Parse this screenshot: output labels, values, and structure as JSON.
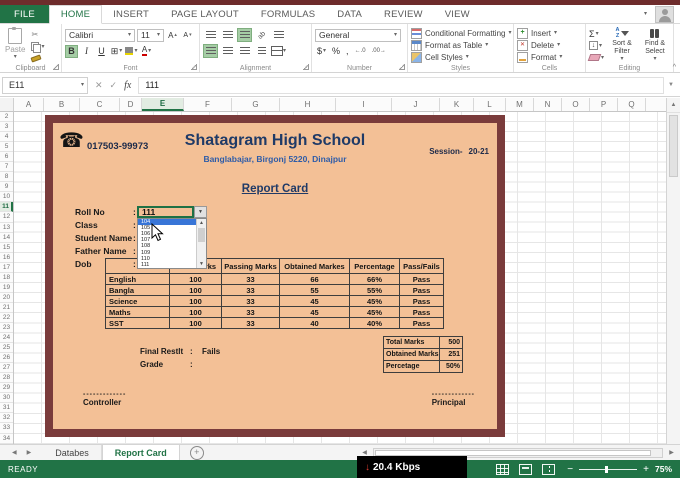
{
  "icons": {
    "caret": "▾",
    "caret_up": "^",
    "check": "✓",
    "cross": "✕",
    "fx": "fx",
    "sigma": "Σ",
    "phone": "☎",
    "up": "▲",
    "down": "▼",
    "left": "◀",
    "right": "▶",
    "plus": "+",
    "minus": "−",
    "fill_down": "↓",
    "net_down": "↓",
    "borders": "⊞",
    "dollar": "$",
    "percent": "%",
    "comma": ",",
    "dec_inc": "←.0",
    "dec_dec": ".00→",
    "grow_font": "A",
    "shrink_font": "A",
    "orientation": "ab",
    "az_a": "A",
    "az_z": "Z",
    "new_sheet": "+",
    "cursor_note": ""
  },
  "ribbon": {
    "tabs": [
      {
        "label": "FILE",
        "file": true
      },
      {
        "label": "HOME",
        "active": true
      },
      {
        "label": "INSERT"
      },
      {
        "label": "PAGE LAYOUT"
      },
      {
        "label": "FORMULAS"
      },
      {
        "label": "DATA"
      },
      {
        "label": "REVIEW"
      },
      {
        "label": "VIEW"
      }
    ],
    "clipboard": {
      "label": "Clipboard",
      "paste": "Paste"
    },
    "font": {
      "label": "Font",
      "family": "Calibri",
      "size": "11",
      "bold": "B",
      "italic": "I",
      "underline": "U"
    },
    "alignment": {
      "label": "Alignment"
    },
    "number": {
      "label": "Number",
      "format": "General"
    },
    "styles": {
      "label": "Styles",
      "conditional": "Conditional Formatting",
      "table": "Format as Table",
      "cell": "Cell Styles"
    },
    "cells": {
      "label": "Cells",
      "insert": "Insert",
      "delete": "Delete",
      "format": "Format"
    },
    "editing": {
      "label": "Editing",
      "sort": "Sort & Filter",
      "find": "Find & Select"
    }
  },
  "formula_bar": {
    "name_box": "E11",
    "value": "111"
  },
  "grid": {
    "columns": [
      {
        "l": "A"
      },
      {
        "l": "B"
      },
      {
        "l": "C"
      },
      {
        "l": "D"
      },
      {
        "l": "E",
        "sel": true
      },
      {
        "l": "F"
      },
      {
        "l": "G"
      },
      {
        "l": "H"
      },
      {
        "l": "I"
      },
      {
        "l": "J"
      },
      {
        "l": "K"
      },
      {
        "l": "L"
      },
      {
        "l": "M"
      },
      {
        "l": "N"
      },
      {
        "l": "O"
      },
      {
        "l": "P"
      },
      {
        "l": "Q"
      }
    ],
    "rows": [
      {
        "n": "2"
      },
      {
        "n": "3"
      },
      {
        "n": "4"
      },
      {
        "n": "5"
      },
      {
        "n": "6"
      },
      {
        "n": "7"
      },
      {
        "n": "8"
      },
      {
        "n": "9"
      },
      {
        "n": "10"
      },
      {
        "n": "11",
        "sel": true
      },
      {
        "n": "12"
      },
      {
        "n": "13"
      },
      {
        "n": "14"
      },
      {
        "n": "15"
      },
      {
        "n": "16"
      },
      {
        "n": "17"
      },
      {
        "n": "18"
      },
      {
        "n": "19"
      },
      {
        "n": "20"
      },
      {
        "n": "21"
      },
      {
        "n": "22"
      },
      {
        "n": "23"
      },
      {
        "n": "24"
      },
      {
        "n": "25"
      },
      {
        "n": "26"
      },
      {
        "n": "27"
      },
      {
        "n": "28"
      },
      {
        "n": "29"
      },
      {
        "n": "30"
      },
      {
        "n": "31"
      },
      {
        "n": "32"
      },
      {
        "n": "33"
      },
      {
        "n": "34"
      }
    ]
  },
  "report_card": {
    "phone": "017503-99973",
    "school": "Shatagram High School",
    "address": "Banglabajar, Birgonj 5220, Dinajpur",
    "session_label": "Session-",
    "session_value": "20-21",
    "title": "Report Card",
    "form": {
      "colon": ":",
      "rows": [
        {
          "label": "Roll No"
        },
        {
          "label": "Class"
        },
        {
          "label": "Student Name"
        },
        {
          "label": "Father Name"
        },
        {
          "label": "Dob"
        }
      ],
      "roll_value": "111"
    },
    "dropdown": {
      "options": [
        {
          "v": "104",
          "sel": true
        },
        {
          "v": "105"
        },
        {
          "v": "106"
        },
        {
          "v": "107"
        },
        {
          "v": "108"
        },
        {
          "v": "109"
        },
        {
          "v": "110"
        },
        {
          "v": "111"
        }
      ]
    },
    "marks": {
      "headers": [
        {
          "h": ""
        },
        {
          "h": "Total Marks"
        },
        {
          "h": "Passing Marks"
        },
        {
          "h": "Obtained Markes"
        },
        {
          "h": "Percentage"
        },
        {
          "h": "Pass/Fails"
        }
      ],
      "rows": [
        {
          "subject": "English",
          "total": "100",
          "passing": "33",
          "obtained": "66",
          "percent": "66%",
          "result": "Pass"
        },
        {
          "subject": "Bangla",
          "total": "100",
          "passing": "33",
          "obtained": "55",
          "percent": "55%",
          "result": "Pass"
        },
        {
          "subject": "Science",
          "total": "100",
          "passing": "33",
          "obtained": "45",
          "percent": "45%",
          "result": "Pass"
        },
        {
          "subject": "Maths",
          "total": "100",
          "passing": "33",
          "obtained": "45",
          "percent": "45%",
          "result": "Pass"
        },
        {
          "subject": "SST",
          "total": "100",
          "passing": "33",
          "obtained": "40",
          "percent": "40%",
          "result": "Pass"
        }
      ]
    },
    "result": {
      "final_label": "Final Restlt",
      "colon": ":",
      "final_value": "Fails",
      "grade_label": "Grade"
    },
    "summary": [
      {
        "label": "Total Marks",
        "value": "500"
      },
      {
        "label": "Obtained Marks",
        "value": "251"
      },
      {
        "label": "Percetage",
        "value": "50%"
      }
    ],
    "sign_dashes": "-------------",
    "sign_left": "Controller",
    "sign_right": "Principal"
  },
  "sheet_tabs": [
    {
      "label": "Databes"
    },
    {
      "label": "Report Card",
      "active": true
    }
  ],
  "status_bar": {
    "ready": "READY",
    "zoom": "75%"
  },
  "network": {
    "speed": "20.4 Kbps"
  },
  "colors": {
    "excel_green": "#217346",
    "card_border": "#7a3b3b",
    "card_bg": "#f3c096",
    "navy": "#1f3a67",
    "blue": "#2e5ca8",
    "dropdown_highlight": "#3875d7"
  }
}
